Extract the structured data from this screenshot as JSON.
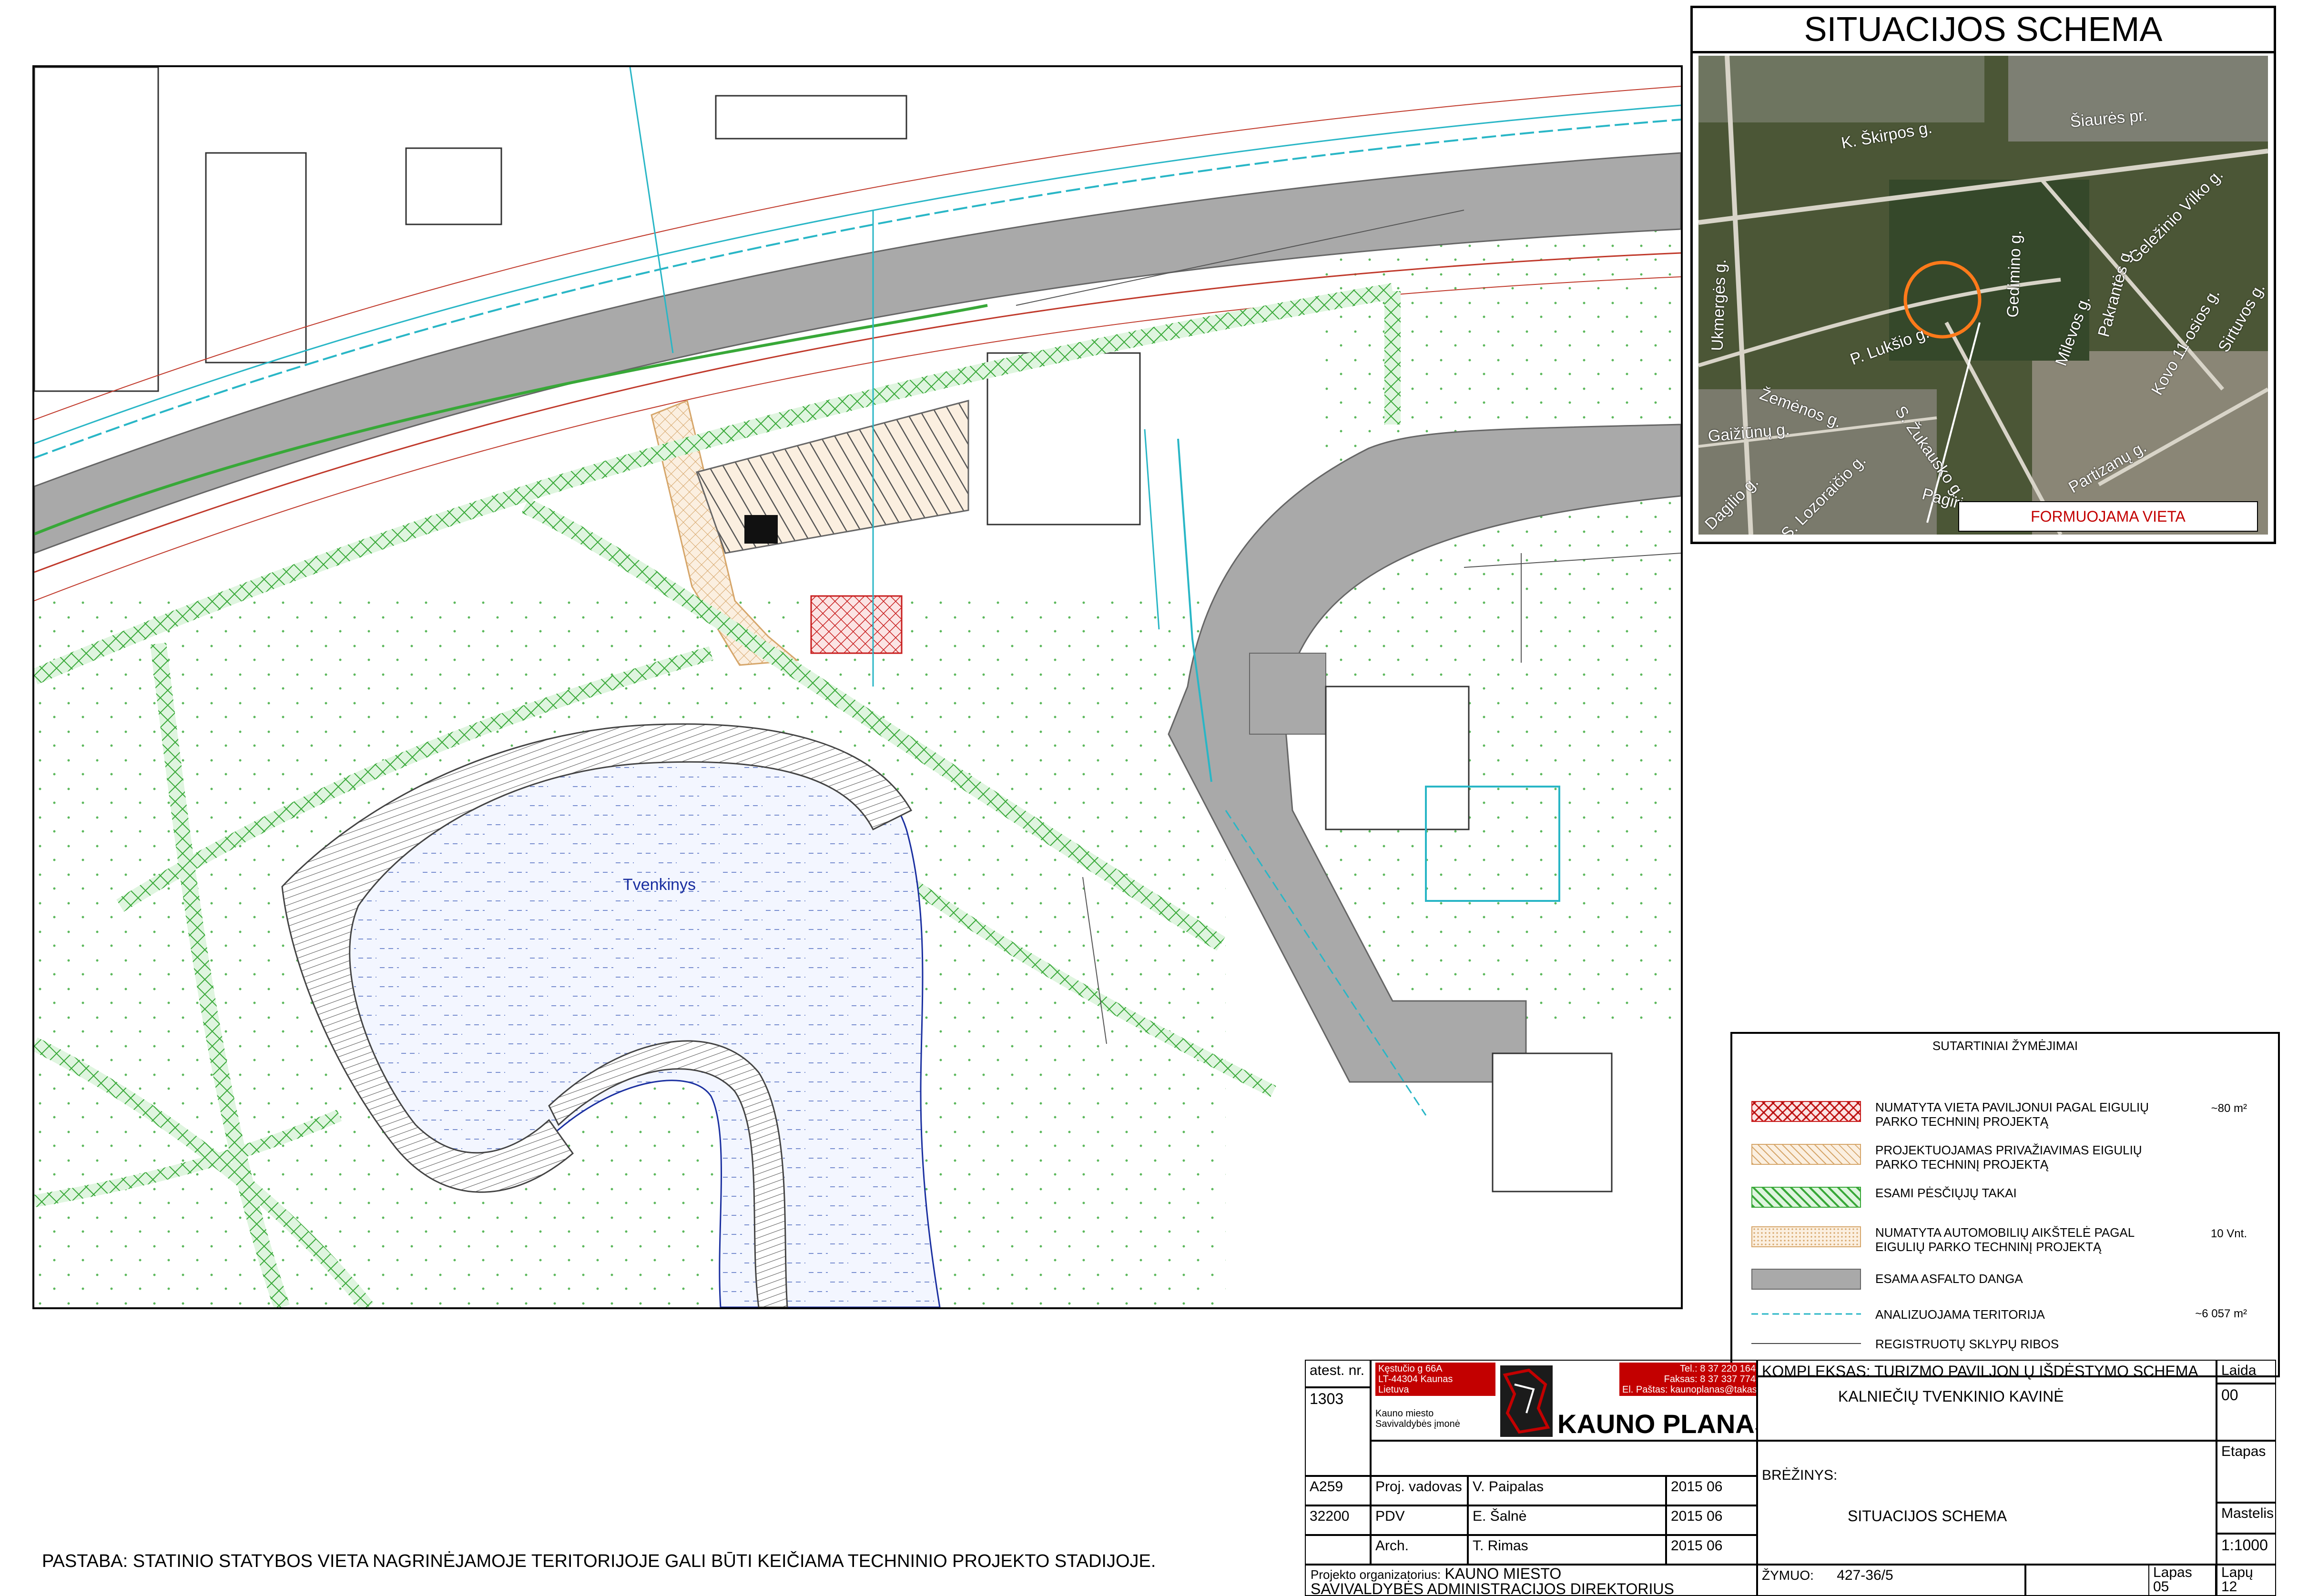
{
  "map": {
    "pond_label": "Tvenkinys"
  },
  "inset": {
    "title": "SITUACIJOS SCHEMA",
    "caption": "FORMUOJAMA VIETA",
    "streets": [
      "K. Škirpos g.",
      "Šiaurės pr.",
      "Ukmergės g.",
      "Geležinio Vilko g.",
      "P. Lukšio g.",
      "Gedimino g.",
      "Milevos g.",
      "Pakrantės g.",
      "Žemėnos g.",
      "S. Žukausko g.",
      "Gaižiūnų g.",
      "Kovo 11-osios g.",
      "Sirtuvos g.",
      "Dagilio g.",
      "S. Lozoraičio g.",
      "Pagirių g.",
      "Partizanų g."
    ]
  },
  "legend": {
    "title": "SUTARTINIAI ŽYMĖJIMAI",
    "items": [
      {
        "label": "NUMATYTA VIETA PAVILJONUI PAGAL EIGULIŲ PARKO TECHNINĮ PROJEKTĄ",
        "value": "~80 m²",
        "swatch": "red-hatch",
        "color": "#cc2222"
      },
      {
        "label": "PROJEKTUOJAMAS PRIVAŽIAVIMAS EIGULIŲ PARKO TECHNINĮ PROJEKTĄ",
        "value": "",
        "swatch": "tan-hatch",
        "color": "#d9b07a"
      },
      {
        "label": "ESAMI PĖSČIŲJŲ TAKAI",
        "value": "",
        "swatch": "green-hatch",
        "color": "#3aaa3a"
      },
      {
        "label": "NUMATYTA AUTOMOBILIŲ AIKŠTELĖ PAGAL EIGULIŲ PARKO TECHNINĮ PROJEKTĄ",
        "value": "10 Vnt.",
        "swatch": "tan-dot",
        "color": "#e0b888"
      },
      {
        "label": "ESAMA ASFALTO DANGA",
        "value": "",
        "swatch": "grey-fill",
        "color": "#a9a9a9"
      },
      {
        "label": "ANALIZUOJAMA TERITORIJA",
        "value": "~6 057 m²",
        "swatch": "cyan-dash",
        "color": "#29b6c6"
      },
      {
        "label": "REGISTRUOTŲ SKLYPŲ RIBOS",
        "value": "",
        "swatch": "thin-line",
        "color": "#444444"
      }
    ]
  },
  "title_block": {
    "atest_label": "atest. nr.",
    "atest_no": "1303",
    "company_address": [
      "Kęstučio g 66A",
      "LT-44304 Kaunas",
      "Lietuva"
    ],
    "company_contacts": [
      "Tel.: 8 37 220 164",
      "Faksas: 8 37 337 774",
      "El. Paštas: kaunoplanas@takas.lt"
    ],
    "company_sub": [
      "Kauno miesto",
      "Savivaldybės įmonė"
    ],
    "company_name": "KAUNO PLANAS",
    "complex_label": "KOMPLEKSAS: TURIZMO PAVILJON Ų IŠDĖSTYMO SCHEMA",
    "object_name": "KALNIEČIŲ TVENKINIO KAVINĖ",
    "laida_label": "Laida",
    "laida": "00",
    "etapas_label": "Etapas",
    "breziny_label": "BRĖŽINYS:",
    "breziny": "SITUACIJOS SCHEMA",
    "mastelis_label": "Mastelis",
    "mastelis": "1:1000",
    "staff": [
      {
        "code": "A259",
        "role": "Proj. vadovas",
        "name": "V. Paipalas",
        "date": "2015 06"
      },
      {
        "code": "32200",
        "role": "PDV",
        "name": "E. Šalnė",
        "date": "2015 06"
      },
      {
        "code": "",
        "role": "Arch.",
        "name": "T. Rimas",
        "date": "2015 06"
      }
    ],
    "organizer_label": "Projekto organizatorius:",
    "organizer_1": "KAUNO MIESTO",
    "organizer_2": "SAVIVALDYBĖS ADMINISTRACIJOS DIREKTORIUS",
    "zymuo_label": "ŽYMUO:",
    "zymuo": "427-36/5",
    "lapas_label": "Lapas",
    "lapas": "05",
    "lapu_label": "Lapų",
    "lapu": "12"
  },
  "note": "PASTABA: STATINIO STATYBOS VIETA NAGRINĖJAMOJE TERITORIJOJE GALI BŪTI KEIČIAMA TECHNINIO PROJEKTO STADIJOJE."
}
